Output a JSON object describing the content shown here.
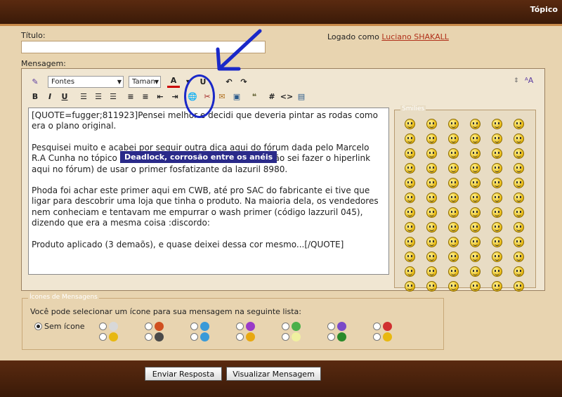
{
  "header": {
    "title": "Tópico"
  },
  "form": {
    "title_label": "Título:",
    "title_value": "",
    "logged_prefix": "Logado como",
    "logged_user": "Luciano SHAKALL",
    "message_label": "Mensagem:"
  },
  "toolbar": {
    "font_select": "Fontes",
    "size_select": "Taman",
    "buttons_row1": [
      "A",
      "U",
      "↶",
      "↷"
    ],
    "buttons_row2": [
      "B",
      "I",
      "U",
      "#",
      "<>"
    ]
  },
  "message": {
    "paragraphs": [
      "[QUOTE=fugger;811923]Pensei melhor e decidi que deveria pintar as rodas como era o plano original.",
      "Pesquisei muito e acabei por seguir outra dica aqui do fórum dada pelo Marcelo R.A Cunha no tópico Deadlock, corrosão entre os anéis (não sei fazer o hiperlink aqui no fórum) de usar o primer fosfatizante da lazuril 8980.",
      "Phoda foi achar este primer aqui em CWB, até pro SAC do fabricante ei tive que ligar para descobrir uma loja que tinha o produto. Na maioria dela, os vendedores nem conheciam e tentavam me empurrar o wash primer (código lazzuril 045), dizendo que era a mesma coisa :discordo:",
      "Produto aplicado (3 demaõs), e quase deixei dessa cor mesmo...[/QUOTE]"
    ],
    "tooltip": "Deadlock, corrosão entre os anéis"
  },
  "smilies": {
    "legend": "Smilies",
    "count": 72
  },
  "post_icons": {
    "legend": "Ícones de Mensagens",
    "prompt": "Você pode selecionar um ícone para sua mensagem na seguinte lista:",
    "no_icon_label": "Sem ícone",
    "selected": "Sem ícone"
  },
  "actions": {
    "submit": "Enviar Resposta",
    "preview": "Visualizar Mensagem"
  },
  "annotation_color": "#1a28c8"
}
